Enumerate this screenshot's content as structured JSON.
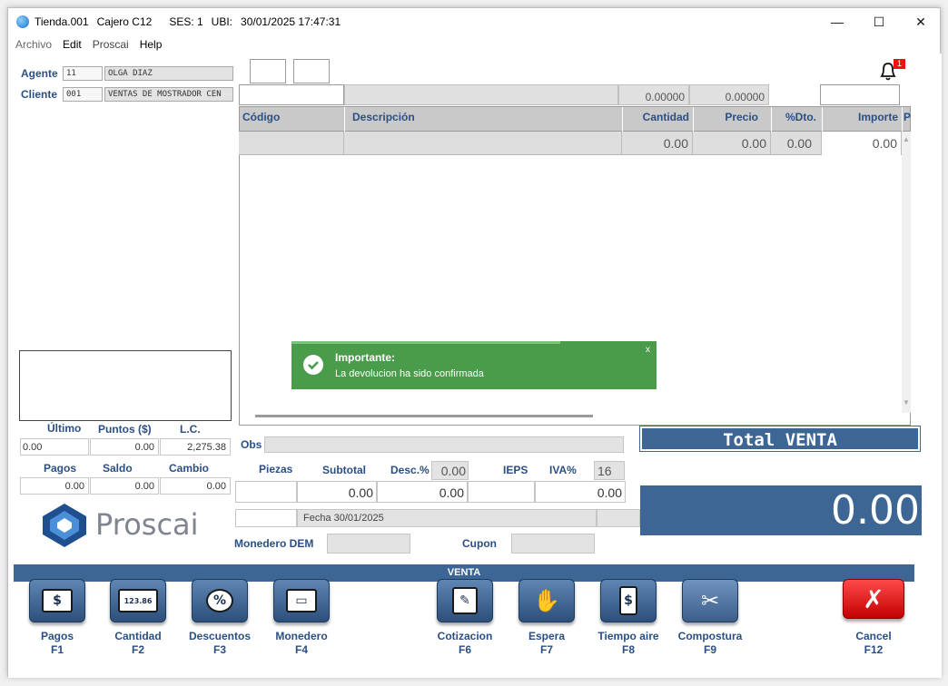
{
  "titlebar": {
    "store": "Tienda.001",
    "cashier": "Cajero C12",
    "session": "SES: 1",
    "ubi": "UBI:",
    "datetime": "30/01/2025 17:47:31"
  },
  "menu": [
    "Archivo",
    "Edit",
    "Proscai",
    "Help"
  ],
  "agent": {
    "label": "Agente",
    "code": "11",
    "name": "OLGA DIAZ"
  },
  "client": {
    "label": "Cliente",
    "code": "001",
    "name": "VENTAS DE MOSTRADOR CEN"
  },
  "notifications": {
    "count": "1"
  },
  "top_values": {
    "v1": "0.00000",
    "v2": "0.00000"
  },
  "grid": {
    "columns": [
      "Código",
      "Descripción",
      "Cantidad",
      "Precio",
      "%Dto.",
      "Importe",
      "P"
    ],
    "row": {
      "cantidad": "0.00",
      "precio": "0.00",
      "dto": "0.00",
      "importe": "0.00"
    }
  },
  "toast": {
    "title": "Importante:",
    "message": "La devolucion ha sido confirmada",
    "close": "x"
  },
  "left_summary": {
    "labels1": [
      "Último",
      "Puntos ($)",
      "L.C."
    ],
    "values1": [
      "0.00",
      "0.00",
      "2,275.38"
    ],
    "labels2": [
      "Pagos",
      "Saldo",
      "Cambio"
    ],
    "values2": [
      "0.00",
      "0.00",
      "0.00"
    ]
  },
  "logo": {
    "text": "Proscai"
  },
  "bottom": {
    "obs_label": "Obs",
    "piezas_label": "Piezas",
    "subtotal_label": "Subtotal",
    "desc_label": "Desc.%",
    "desc_value": "0.00",
    "ieps_label": "IEPS",
    "iva_label": "IVA%",
    "iva_value": "16",
    "subtotal_value": "0.00",
    "desc_amount": "0.00",
    "iva_amount": "0.00",
    "fecha": "Fecha 30/01/2025",
    "monedero_label": "Monedero DEM",
    "cupon_label": "Cupon"
  },
  "total": {
    "label": "Total VENTA",
    "value": "0.00"
  },
  "mode_bar": "VENTA",
  "fkeys": [
    {
      "label": "Pagos",
      "key": "F1",
      "glyph": "$"
    },
    {
      "label": "Cantidad",
      "key": "F2",
      "glyph": "123.86"
    },
    {
      "label": "Descuentos",
      "key": "F3",
      "glyph": "%"
    },
    {
      "label": "Monedero",
      "key": "F4",
      "glyph": "▭"
    },
    {
      "label": "Cotizacion",
      "key": "F6",
      "glyph": "✎"
    },
    {
      "label": "Espera",
      "key": "F7",
      "glyph": "✋"
    },
    {
      "label": "Tiempo aire",
      "key": "F8",
      "glyph": "$"
    },
    {
      "label": "Compostura",
      "key": "F9",
      "glyph": "✂"
    },
    {
      "label": "Cancel",
      "key": "F12",
      "glyph": "✗"
    }
  ]
}
